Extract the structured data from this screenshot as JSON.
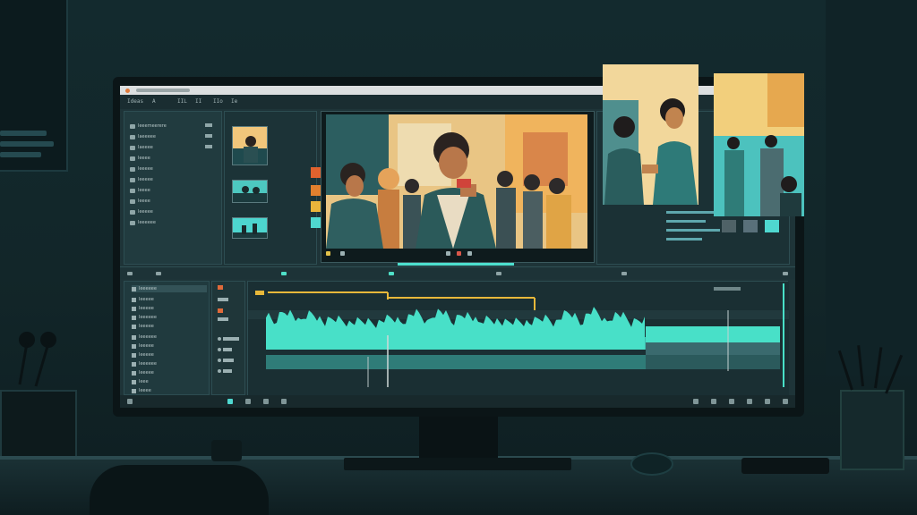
{
  "app": {
    "title_bar": "",
    "menu": [
      "Ideas",
      "A",
      "IIL",
      "II",
      "IIo",
      "Ie"
    ]
  },
  "project_panel": {
    "items": [
      {
        "label": "Ieeemeerere"
      },
      {
        "label": "Iaeeeee"
      },
      {
        "label": "Iaeeee"
      },
      {
        "label": "Ieeee"
      },
      {
        "label": "Ieeeee"
      },
      {
        "label": "Ieeeee"
      },
      {
        "label": "Ieeee"
      },
      {
        "label": "Ieeee"
      },
      {
        "label": "Ieeeee"
      },
      {
        "label": "Ieeeeee"
      }
    ]
  },
  "swatch_colors": [
    "#e0622e",
    "#e2802e",
    "#e9b53b",
    "#4fd8d0"
  ],
  "timeline_tracks": {
    "items": [
      {
        "label": "Ieeeeee"
      },
      {
        "label": "Ieeeee"
      },
      {
        "label": "Ieeeee"
      },
      {
        "label": "Ieeeeee"
      },
      {
        "label": "Ieeeee"
      },
      {
        "label": "Ieeeeee"
      },
      {
        "label": "Ieeeee"
      },
      {
        "label": "Ieeeee"
      },
      {
        "label": "Ieeeeee"
      },
      {
        "label": "Ieeeee"
      },
      {
        "label": "Ieee"
      },
      {
        "label": "Ieeee"
      }
    ]
  },
  "accent_colors": {
    "waveform": "#4fe0c8",
    "playhead": "#e8b83a",
    "panel": "#1e3438"
  },
  "chips": [
    "#4f6267",
    "#59707a",
    "#4fd8d0"
  ]
}
